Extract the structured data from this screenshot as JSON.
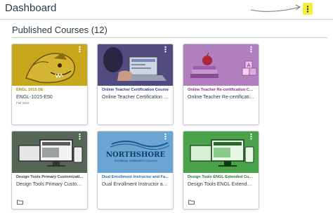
{
  "header": {
    "title": "Dashboard",
    "menu_icon": "kebab-icon"
  },
  "section": {
    "title": "Published Courses (12)"
  },
  "colors": {
    "accent_highlight": "#f5ef3a",
    "text": "#2d3b45"
  },
  "cards": [
    {
      "code": "ENGL 1015 DE",
      "name": "ENGL-1015-E50",
      "term": "Fall 2022",
      "color": "#b08a10"
    },
    {
      "code": "Online Teacher Certification Course",
      "name": "Online Teacher Certification C...",
      "term": "",
      "color": "#2b3a8f"
    },
    {
      "code": "Online Teacher Re-certification Course",
      "name": "Online Teacher Re-certification ...",
      "term": "",
      "color": "#8a2d8f"
    },
    {
      "code": "Design Tools Primary Customizati...",
      "name": "Design Tools Primary Customizi...",
      "term": "",
      "color": "#3a4a3a"
    },
    {
      "code": "Dual Enrollment Instructor and Fa...",
      "name": "Dual Enrollment Instructor an...",
      "term": "",
      "color": "#2a6fb0"
    },
    {
      "code": "Design Tools ENGL Extended Cust...",
      "name": "Design Tools ENGL Extended ...",
      "term": "",
      "color": "#1f7a1f"
    }
  ],
  "logo_text": {
    "line1": "NORTHSHORE",
    "line2": "TECHNICAL COMMUNITY COLLEGE"
  }
}
